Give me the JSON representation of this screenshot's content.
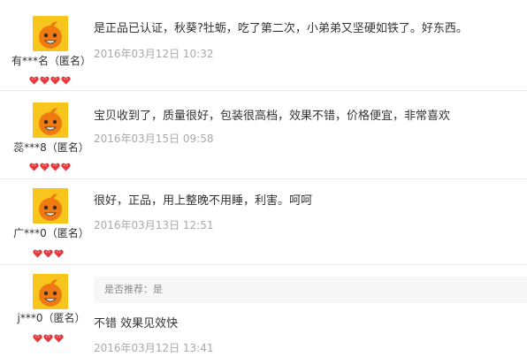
{
  "reviews": [
    {
      "username": "有***名（匿名）",
      "text": "是正品已认证，秋葵?牡蛎，吃了第二次，小弟弟又坚硬如铁了。好东西。",
      "date": "2016年03月12日 10:32",
      "hearts": 4
    },
    {
      "username": "蕊***8（匿名）",
      "text": "宝贝收到了，质量很好，包装很高档，效果不错，价格便宜，非常喜欢",
      "date": "2016年03月15日 09:58",
      "hearts": 4
    },
    {
      "username": "广***0（匿名）",
      "text": "很好，正品，用上整晚不用睡，利害。呵呵",
      "date": "2016年03月13日 12:51",
      "hearts": 3
    },
    {
      "username": "j***0（匿名）",
      "recommend_label": "是否推荐：是",
      "text": "不错 效果见效快",
      "date": "2016年03月12日 13:41",
      "hearts": 3
    }
  ],
  "colors": {
    "avatar_bg": "#f8c51c",
    "heart": "#e4393c",
    "date": "#aaaaaa"
  },
  "icons": {
    "avatar": "orange-mascot-avatar-icon",
    "rating": "heart-gem-icon"
  }
}
